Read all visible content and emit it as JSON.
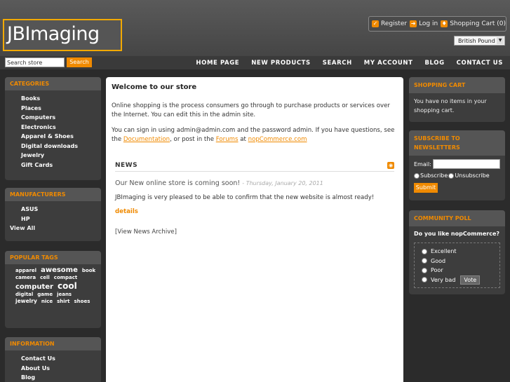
{
  "header": {
    "logo": "JBImaging",
    "links": [
      {
        "label": "Register",
        "icon": "register-icon"
      },
      {
        "label": "Log in",
        "icon": "login-icon"
      },
      {
        "label": "Shopping Cart (0)",
        "icon": "cart-icon"
      }
    ],
    "currency": "British Pound"
  },
  "search": {
    "placeholder": "Search store",
    "button": "Search"
  },
  "nav": [
    "HOME PAGE",
    "NEW PRODUCTS",
    "SEARCH",
    "MY ACCOUNT",
    "BLOG",
    "CONTACT US"
  ],
  "categories": {
    "title": "CATEGORIES",
    "items": [
      "Books",
      "Places",
      "Computers",
      "Electronics",
      "Apparel & Shoes",
      "Digital downloads",
      "Jewelry",
      "Gift Cards"
    ]
  },
  "manufacturers": {
    "title": "MANUFACTURERS",
    "items": [
      "ASUS",
      "HP"
    ],
    "view_all": "View All"
  },
  "popular_tags": {
    "title": "POPULAR TAGS",
    "tags": [
      {
        "name": "apparel",
        "size": 7
      },
      {
        "name": "awesome",
        "size": 10
      },
      {
        "name": "book",
        "size": 7
      },
      {
        "name": "camera",
        "size": 7
      },
      {
        "name": "cell",
        "size": 7
      },
      {
        "name": "compact",
        "size": 7
      },
      {
        "name": "computer",
        "size": 10
      },
      {
        "name": "cool",
        "size": 12
      },
      {
        "name": "digital",
        "size": 7
      },
      {
        "name": "game",
        "size": 7
      },
      {
        "name": "jeans",
        "size": 7
      },
      {
        "name": "jewelry",
        "size": 7.5
      },
      {
        "name": "nice",
        "size": 7
      },
      {
        "name": "shirt",
        "size": 7
      },
      {
        "name": "shoes",
        "size": 7
      }
    ]
  },
  "information": {
    "title": "INFORMATION",
    "items": [
      "Contact Us",
      "About Us",
      "Blog"
    ]
  },
  "main": {
    "title": "Welcome to our store",
    "para1": "Online shopping is the process consumers go through to purchase products or services over the Internet. You can edit this in the admin site.",
    "para2_a": "You can sign in using admin@admin.com and the password admin. If you have questions, see the",
    "para2_link1": "Documentation",
    "para2_b": ", or post in the",
    "para2_link2": "Forums",
    "para2_c": "at",
    "para2_link3": "nopCommerce.com",
    "news_title": "NEWS",
    "news_item_title": "Our New online store is coming soon!",
    "news_date": "- Thursday, January 20, 2011",
    "news_text": "JBImaging is very pleased to be able to confirm that the new website is almost ready!",
    "details": "details",
    "archive": "[View News Archive]"
  },
  "shopping_cart": {
    "title": "SHOPPING CART",
    "text": "You have no items in your shopping cart."
  },
  "newsletter": {
    "title": "SUBSCRIBE TO NEWSLETTERS",
    "email_label": "Email:",
    "subscribe": "Subscribe",
    "unsubscribe": "Unsubscribe",
    "submit": "Submit"
  },
  "poll": {
    "title": "COMMUNITY POLL",
    "question": "Do you like nopCommerce?",
    "options": [
      "Excellent",
      "Good",
      "Poor",
      "Very bad"
    ],
    "vote": "Vote"
  },
  "colors": {
    "accent": "#f08a00",
    "panel": "#3d3d3d",
    "background": "#2b2b2b"
  }
}
